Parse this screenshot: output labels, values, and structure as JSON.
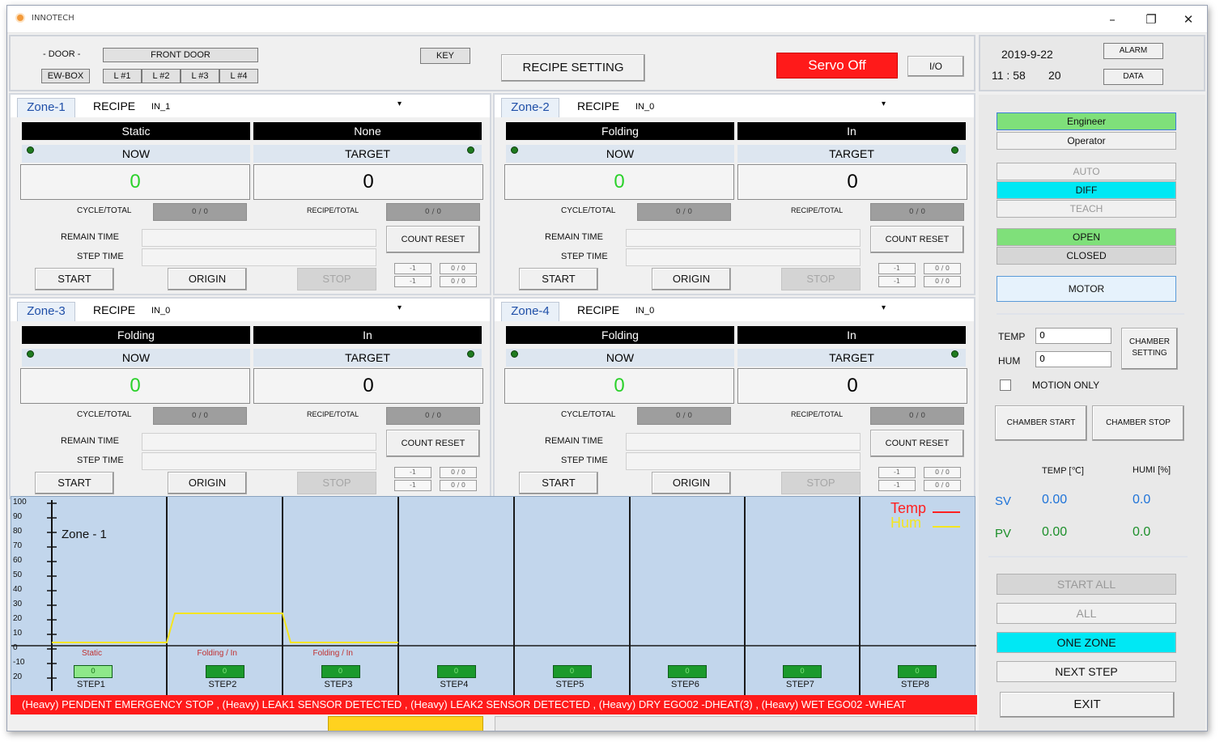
{
  "window": {
    "title": "INNOTECH",
    "minimize": "–",
    "maximize": "❐",
    "close": "✕"
  },
  "header": {
    "door_label": "- DOOR -",
    "front_door": "FRONT DOOR",
    "ew_box": "EW-BOX",
    "layers": [
      "L #1",
      "L #2",
      "L #3",
      "L #4"
    ],
    "key": "KEY",
    "recipe_setting": "RECIPE SETTING",
    "servo": "Servo Off",
    "io": "I/O"
  },
  "status": {
    "date": "2019-9-22",
    "time_hm": "11 : 58",
    "time_s": "20",
    "alarm": "ALARM",
    "data": "DATA"
  },
  "zones": [
    {
      "tab": "Zone-1",
      "recipe_label": "RECIPE",
      "recipe": "IN_1",
      "mode_left": "Static",
      "mode_right": "None",
      "now_label": "NOW",
      "target_label": "TARGET",
      "now": "0",
      "target": "0",
      "cycle_label": "CYCLE/TOTAL",
      "cycle": "0 / 0",
      "recipe_total_label": "RECIPE/TOTAL",
      "recipe_total": "0 / 0",
      "remain_label": "REMAIN TIME",
      "step_label": "STEP TIME",
      "count_reset": "COUNT RESET",
      "start": "START",
      "origin": "ORIGIN",
      "stop": "STOP",
      "mini_a": "-1",
      "mini_b": "0 / 0",
      "mini_c": "-1",
      "mini_d": "0 / 0"
    },
    {
      "tab": "Zone-2",
      "recipe_label": "RECIPE",
      "recipe": "IN_0",
      "mode_left": "Folding",
      "mode_right": "In",
      "now_label": "NOW",
      "target_label": "TARGET",
      "now": "0",
      "target": "0",
      "cycle_label": "CYCLE/TOTAL",
      "cycle": "0 / 0",
      "recipe_total_label": "RECIPE/TOTAL",
      "recipe_total": "0 / 0",
      "remain_label": "REMAIN TIME",
      "step_label": "STEP TIME",
      "count_reset": "COUNT RESET",
      "start": "START",
      "origin": "ORIGIN",
      "stop": "STOP",
      "mini_a": "-1",
      "mini_b": "0 / 0",
      "mini_c": "-1",
      "mini_d": "0 / 0"
    },
    {
      "tab": "Zone-3",
      "recipe_label": "RECIPE",
      "recipe": "IN_0",
      "mode_left": "Folding",
      "mode_right": "In",
      "now_label": "NOW",
      "target_label": "TARGET",
      "now": "0",
      "target": "0",
      "cycle_label": "CYCLE/TOTAL",
      "cycle": "0 / 0",
      "recipe_total_label": "RECIPE/TOTAL",
      "recipe_total": "0 / 0",
      "remain_label": "REMAIN TIME",
      "step_label": "STEP TIME",
      "count_reset": "COUNT RESET",
      "start": "START",
      "origin": "ORIGIN",
      "stop": "STOP",
      "mini_a": "-1",
      "mini_b": "0 / 0",
      "mini_c": "-1",
      "mini_d": "0 / 0"
    },
    {
      "tab": "Zone-4",
      "recipe_label": "RECIPE",
      "recipe": "IN_0",
      "mode_left": "Folding",
      "mode_right": "In",
      "now_label": "NOW",
      "target_label": "TARGET",
      "now": "0",
      "target": "0",
      "cycle_label": "CYCLE/TOTAL",
      "cycle": "0 / 0",
      "recipe_total_label": "RECIPE/TOTAL",
      "recipe_total": "0 / 0",
      "remain_label": "REMAIN TIME",
      "step_label": "STEP TIME",
      "count_reset": "COUNT RESET",
      "start": "START",
      "origin": "ORIGIN",
      "stop": "STOP",
      "mini_a": "-1",
      "mini_b": "0 / 0",
      "mini_c": "-1",
      "mini_d": "0 / 0"
    }
  ],
  "chart": {
    "zone_label": "Zone - 1",
    "legend_temp": "Temp",
    "legend_hum": "Hum",
    "y_ticks": [
      "100",
      "90",
      "80",
      "70",
      "60",
      "50",
      "40",
      "30",
      "20",
      "10",
      "0",
      "-10",
      "20"
    ],
    "step_modes": [
      "Static",
      "Folding / In",
      "Folding / In"
    ],
    "steps": [
      "STEP1",
      "STEP2",
      "STEP3",
      "STEP4",
      "STEP5",
      "STEP6",
      "STEP7",
      "STEP8"
    ],
    "step_values": [
      "0",
      "0",
      "0",
      "0",
      "0",
      "0",
      "0",
      "0"
    ],
    "profile": [
      0,
      0,
      20,
      20,
      0,
      0
    ]
  },
  "alarm_text": "(Heavy) PENDENT EMERGENCY STOP ,  (Heavy) LEAK1 SENSOR DETECTED ,  (Heavy) LEAK2 SENSOR DETECTED ,  (Heavy) DRY EGO02 -DHEAT(3) ,  (Heavy) WET EGO02 -WHEAT",
  "right": {
    "engineer": "Engineer",
    "operator": "Operator",
    "auto": "AUTO",
    "diff": "DIFF",
    "teach": "TEACH",
    "open": "OPEN",
    "closed": "CLOSED",
    "motor": "MOTOR",
    "temp_label": "TEMP",
    "temp_value": "0",
    "hum_label": "HUM",
    "hum_value": "0",
    "chamber_setting_1": "CHAMBER",
    "chamber_setting_2": "SETTING",
    "motion_only": "MOTION ONLY",
    "chamber_start": "CHAMBER START",
    "chamber_stop": "CHAMBER STOP",
    "temp_unit_label": "TEMP [℃]",
    "hum_unit_label": "HUMI [%]",
    "sv_label": "SV",
    "sv_temp": "0.00",
    "sv_hum": "0.0",
    "pv_label": "PV",
    "pv_temp": "0.00",
    "pv_hum": "0.0",
    "start_all": "START ALL",
    "all": "ALL",
    "one_zone": "ONE ZONE",
    "next_step": "NEXT STEP",
    "exit": "EXIT"
  },
  "colors": {
    "accent_green": "#7fe07a",
    "accent_cyan": "#00e8f4",
    "servo_red": "#ff1a1a",
    "now_value": "#2bd12b"
  }
}
